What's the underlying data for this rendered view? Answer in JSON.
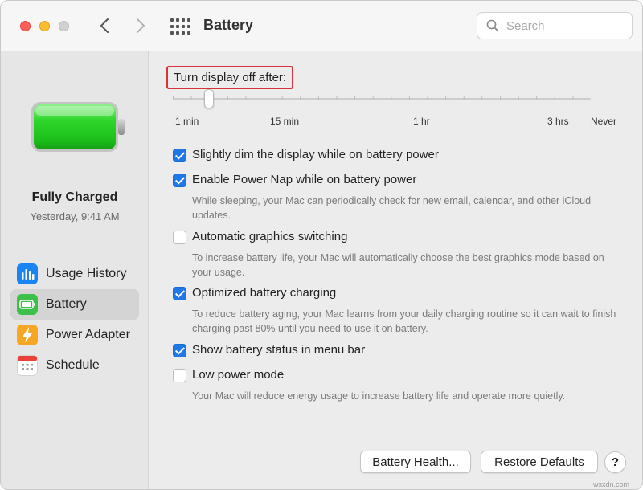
{
  "window": {
    "title": "Battery"
  },
  "toolbar": {
    "search_placeholder": "Search"
  },
  "sidebar": {
    "status_title": "Fully Charged",
    "status_time": "Yesterday, 9:41 AM",
    "battery_level": 1.0,
    "items": [
      {
        "label": "Usage History",
        "icon": "bar-chart-icon",
        "color": "#1a84f2"
      },
      {
        "label": "Battery",
        "icon": "battery-icon",
        "color": "#3cc04a"
      },
      {
        "label": "Power Adapter",
        "icon": "bolt-icon",
        "color": "#f5a623"
      },
      {
        "label": "Schedule",
        "icon": "calendar-icon",
        "color": "#e9413a"
      }
    ]
  },
  "display_off": {
    "label": "Turn display off after:",
    "selected_tick_index": 2,
    "tick_labels": [
      "1 min",
      "15 min",
      "1 hr",
      "3 hrs",
      "Never"
    ]
  },
  "options": [
    {
      "label": "Slightly dim the display while on battery power",
      "checked": true,
      "description": ""
    },
    {
      "label": "Enable Power Nap while on battery power",
      "checked": true,
      "description": "While sleeping, your Mac can periodically check for new email, calendar, and other iCloud updates."
    },
    {
      "label": "Automatic graphics switching",
      "checked": false,
      "description": "To increase battery life, your Mac will automatically choose the best graphics mode based on your usage."
    },
    {
      "label": "Optimized battery charging",
      "checked": true,
      "description": "To reduce battery aging, your Mac learns from your daily charging routine so it can wait to finish charging past 80% until you need to use it on battery."
    },
    {
      "label": "Show battery status in menu bar",
      "checked": true,
      "description": ""
    },
    {
      "label": "Low power mode",
      "checked": false,
      "description": "Your Mac will reduce energy usage to increase battery life and operate more quietly."
    }
  ],
  "buttons": {
    "battery_health": "Battery Health...",
    "restore_defaults": "Restore Defaults",
    "help": "?"
  },
  "watermark": "wsxdn.com",
  "colors": {
    "accent": "#1f78e6",
    "highlight_box": "#d4343a",
    "battery_green": "#3dd63d"
  }
}
